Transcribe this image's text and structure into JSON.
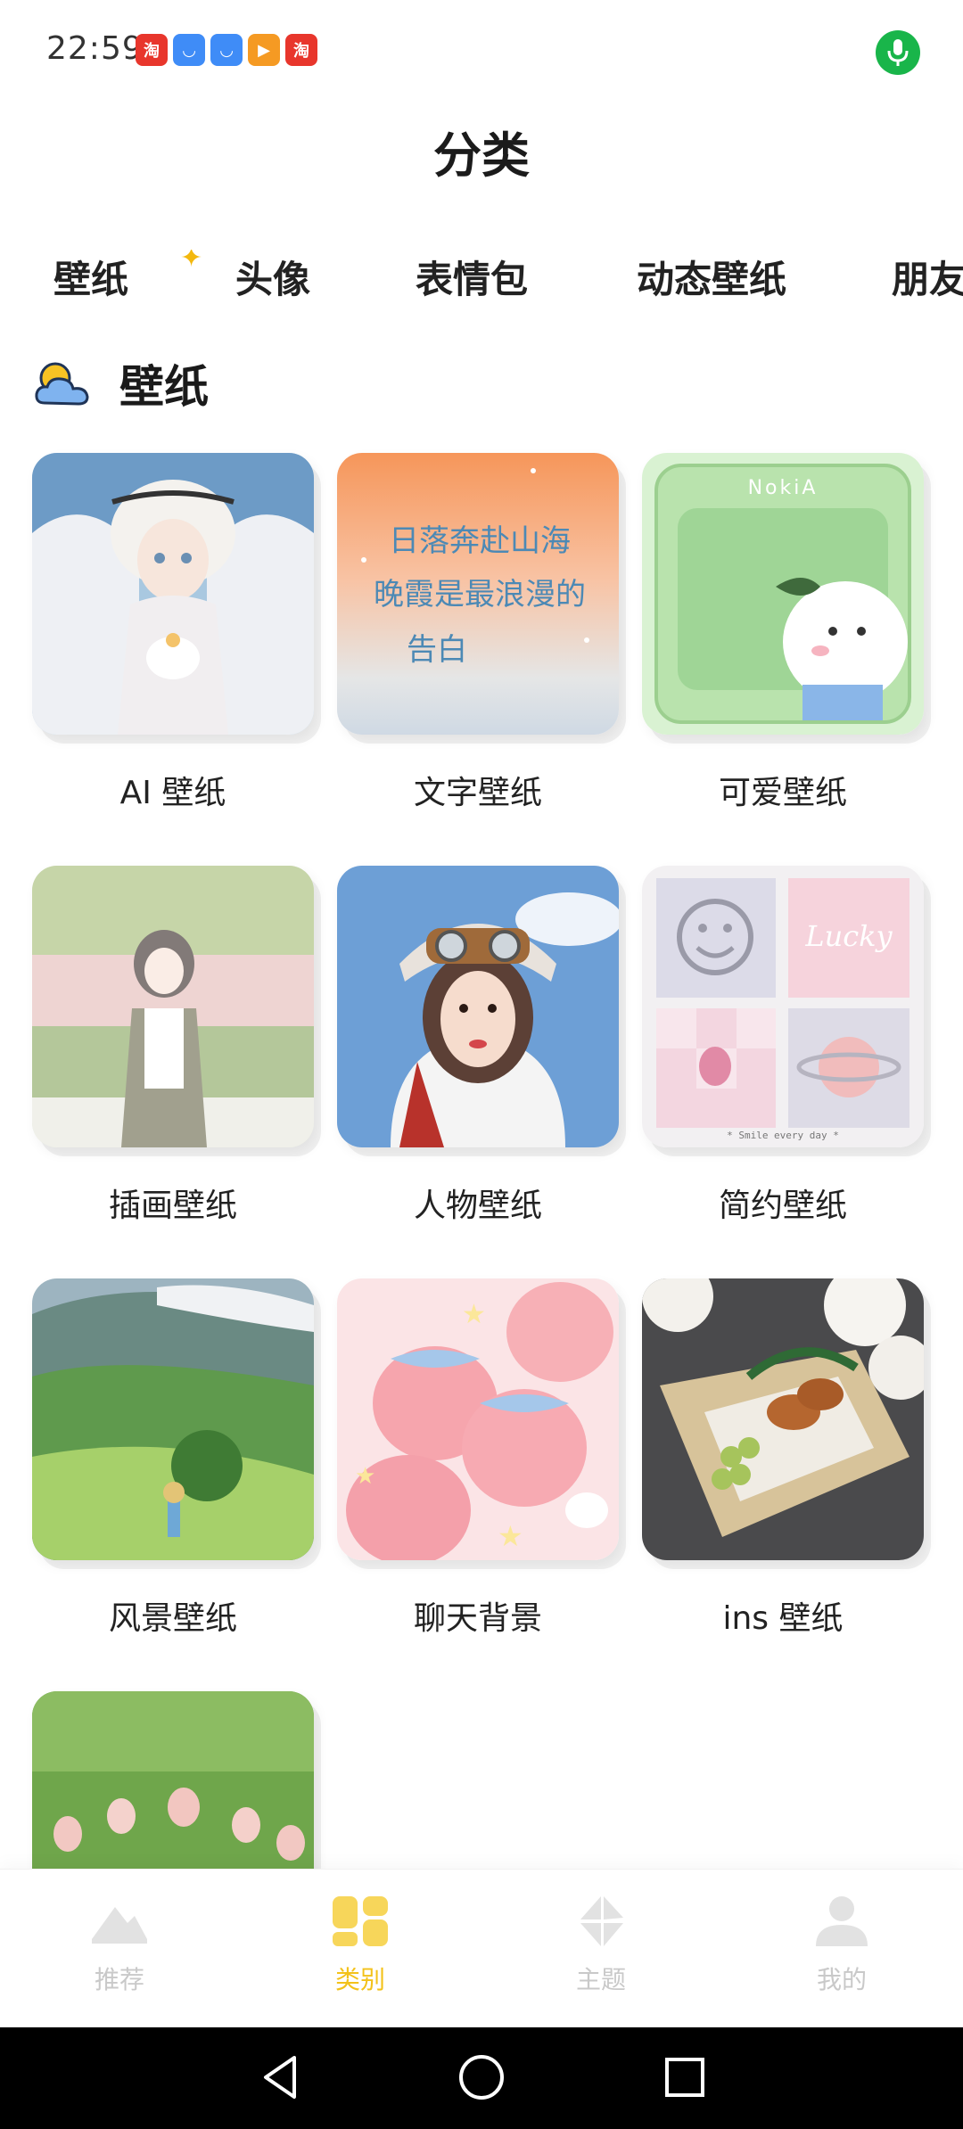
{
  "status_bar": {
    "time": "22:59",
    "notification_icons": [
      {
        "name": "taobao-icon",
        "color": "#e8362c",
        "glyph": "淘"
      },
      {
        "name": "app-store-icon",
        "color": "#3f8cf7",
        "glyph": "◡"
      },
      {
        "name": "app-store-icon",
        "color": "#3f8cf7",
        "glyph": "◡"
      },
      {
        "name": "video-play-icon",
        "color": "#f59a23",
        "glyph": "▶"
      },
      {
        "name": "taobao-icon",
        "color": "#e8362c",
        "glyph": "淘"
      }
    ],
    "mic_color": "#19b54a"
  },
  "page_title": "分类",
  "tabs": [
    {
      "label": "壁纸",
      "active": true
    },
    {
      "label": "头像",
      "active": false
    },
    {
      "label": "表情包",
      "active": false
    },
    {
      "label": "动态壁纸",
      "active": false
    },
    {
      "label": "朋友",
      "active": false
    }
  ],
  "section": {
    "title": "壁纸",
    "icon": "cloud-sun-icon"
  },
  "items": [
    {
      "label": "AI 壁纸"
    },
    {
      "label": "文字壁纸",
      "image_text": [
        "日落奔赴山海",
        "晚霞是最浪漫的",
        "告白"
      ]
    },
    {
      "label": "可爱壁纸",
      "image_text": "NokiA"
    },
    {
      "label": "插画壁纸"
    },
    {
      "label": "人物壁纸"
    },
    {
      "label": "简约壁纸",
      "image_text": [
        "Lucky",
        "* Smile every day *"
      ]
    },
    {
      "label": "风景壁纸"
    },
    {
      "label": "聊天背景"
    },
    {
      "label": "ins 壁纸"
    },
    {
      "label": ""
    }
  ],
  "bottom_nav": [
    {
      "label": "推荐",
      "icon": "mountain-icon",
      "active": false
    },
    {
      "label": "类别",
      "icon": "category-grid-icon",
      "active": true
    },
    {
      "label": "主题",
      "icon": "theme-pinwheel-icon",
      "active": false
    },
    {
      "label": "我的",
      "icon": "profile-icon",
      "active": false
    }
  ],
  "colors": {
    "accent": "#f3c21a",
    "inactive": "#c9c9c9"
  }
}
